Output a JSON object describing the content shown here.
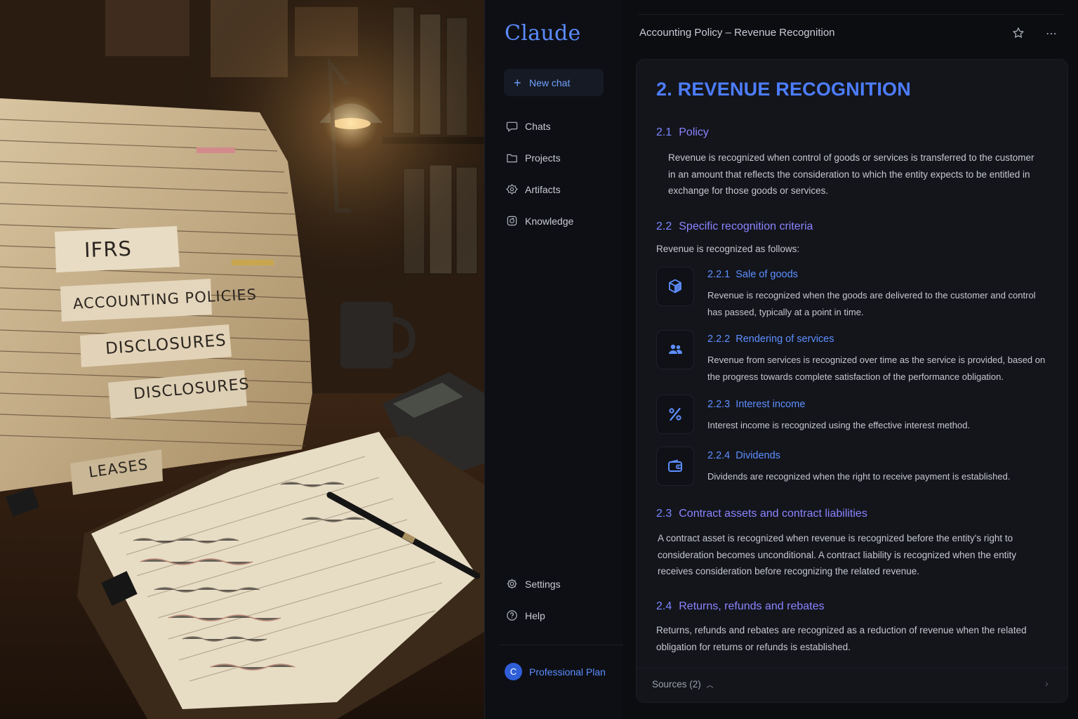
{
  "photo": {
    "tabs": [
      "IFRS",
      "ACCOUNTING POLICIES",
      "DISCLOSURES",
      "DISCLOSURES",
      "LEASES"
    ]
  },
  "sidebar": {
    "brand": "Claude",
    "new_chat_label": "New chat",
    "items": [
      {
        "label": "Chats",
        "icon": "chat-icon"
      },
      {
        "label": "Projects",
        "icon": "folder-icon"
      },
      {
        "label": "Artifacts",
        "icon": "artifacts-icon"
      },
      {
        "label": "Knowledge",
        "icon": "knowledge-icon"
      }
    ],
    "bottom_items": [
      {
        "label": "Settings",
        "icon": "gear-icon"
      },
      {
        "label": "Help",
        "icon": "help-icon"
      }
    ],
    "plan": {
      "avatar_letter": "C",
      "label": "Professional Plan"
    }
  },
  "header": {
    "title": "Accounting Policy – Revenue Recognition",
    "star_icon": "star-icon",
    "more_icon": "more-icon"
  },
  "document": {
    "heading": "2. REVENUE RECOGNITION",
    "sections": [
      {
        "num": "2.1",
        "title": "Policy",
        "body": "Revenue is recognized when control of goods or services is transferred to the customer in an amount that reflects the consideration to which the entity expects to be entitled in exchange for those goods or services."
      },
      {
        "num": "2.2",
        "title": "Specific recognition criteria",
        "intro": "Revenue is recognized as follows:",
        "criteria": [
          {
            "num": "2.2.1",
            "title": "Sale of goods",
            "icon": "box-icon",
            "body": "Revenue is recognized when the goods are delivered to the customer and control has passed, typically at a point in time."
          },
          {
            "num": "2.2.2",
            "title": "Rendering of services",
            "icon": "users-icon",
            "body": "Revenue from services is recognized over time as the service is provided, based on the progress towards complete satisfaction of the performance obligation."
          },
          {
            "num": "2.2.3",
            "title": "Interest income",
            "icon": "percent-icon",
            "body": "Interest income is recognized using the effective interest method."
          },
          {
            "num": "2.2.4",
            "title": "Dividends",
            "icon": "wallet-icon",
            "body": "Dividends are recognized when the right to receive payment is established."
          }
        ]
      },
      {
        "num": "2.3",
        "title": "Contract assets and contract liabilities",
        "body": "A contract asset is recognized when revenue is recognized before the entity's right to consideration becomes unconditional. A contract liability is recognized when the entity receives consideration before recognizing the related revenue."
      },
      {
        "num": "2.4",
        "title": "Returns, refunds and rebates",
        "body": "Returns, refunds and rebates are recognized as a reduction of revenue when the related obligation for returns or refunds is established."
      }
    ],
    "sources_label": "Sources (2)"
  },
  "colors": {
    "accent": "#5b8cff",
    "heading": "#4d7dff",
    "section": "#8c83ff"
  }
}
